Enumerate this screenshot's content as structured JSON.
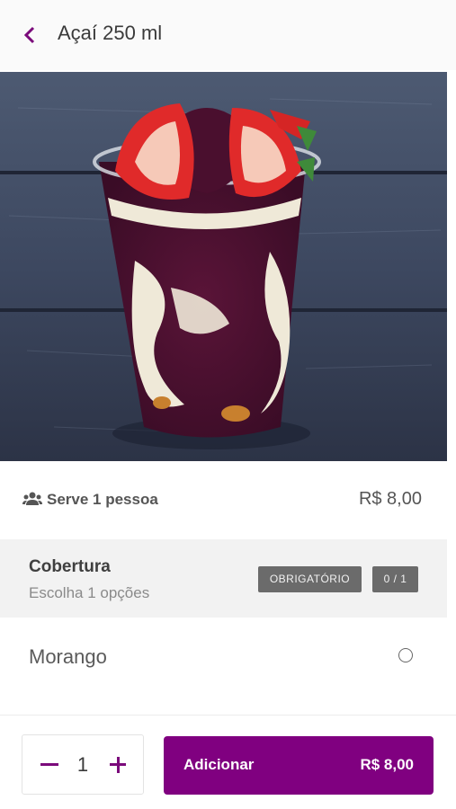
{
  "header": {
    "title": "Açaí 250 ml",
    "back_icon": "chevron-left-icon"
  },
  "product": {
    "image": "acai-cup-with-strawberries-photo",
    "serves_icon": "people-icon",
    "serves_label": "Serve 1 pessoa",
    "price": "R$ 8,00"
  },
  "options_group": {
    "title": "Cobertura",
    "subtitle": "Escolha 1 opções",
    "required_badge": "OBRIGATÓRIO",
    "count_badge": "0 / 1",
    "items": [
      {
        "label": "Morango",
        "selected": false
      }
    ]
  },
  "footer": {
    "quantity": "1",
    "add_label": "Adicionar",
    "add_price": "R$ 8,00"
  },
  "colors": {
    "brand": "#800080",
    "badge": "#6b6b6b",
    "section_bg": "#f2f2f2"
  }
}
